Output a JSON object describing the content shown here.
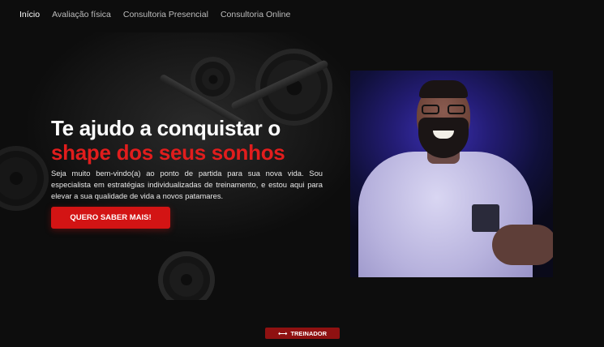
{
  "nav": {
    "items": [
      {
        "label": "Início",
        "active": true
      },
      {
        "label": "Avaliação física",
        "active": false
      },
      {
        "label": "Consultoria Presencial",
        "active": false
      },
      {
        "label": "Consultoria Online",
        "active": false
      }
    ]
  },
  "hero": {
    "headline_line1": "Te ajudo a conquistar o",
    "headline_line2": "shape dos seus sonhos",
    "intro": "Seja muito bem-vindo(a) ao ponto de partida para sua nova vida. Sou especialista em estratégias individualizadas de treinamento, e estou aqui para elevar a sua qualidade de vida a novos patamares.",
    "cta_label": "QUERO SABER MAIS!"
  },
  "badge": {
    "icon": "dumbbell-icon",
    "label": "TREINADOR"
  },
  "colors": {
    "accent": "#d31414",
    "headline_red": "#e11d1d",
    "background": "#0d0d0d",
    "badge": "#8f1111"
  }
}
